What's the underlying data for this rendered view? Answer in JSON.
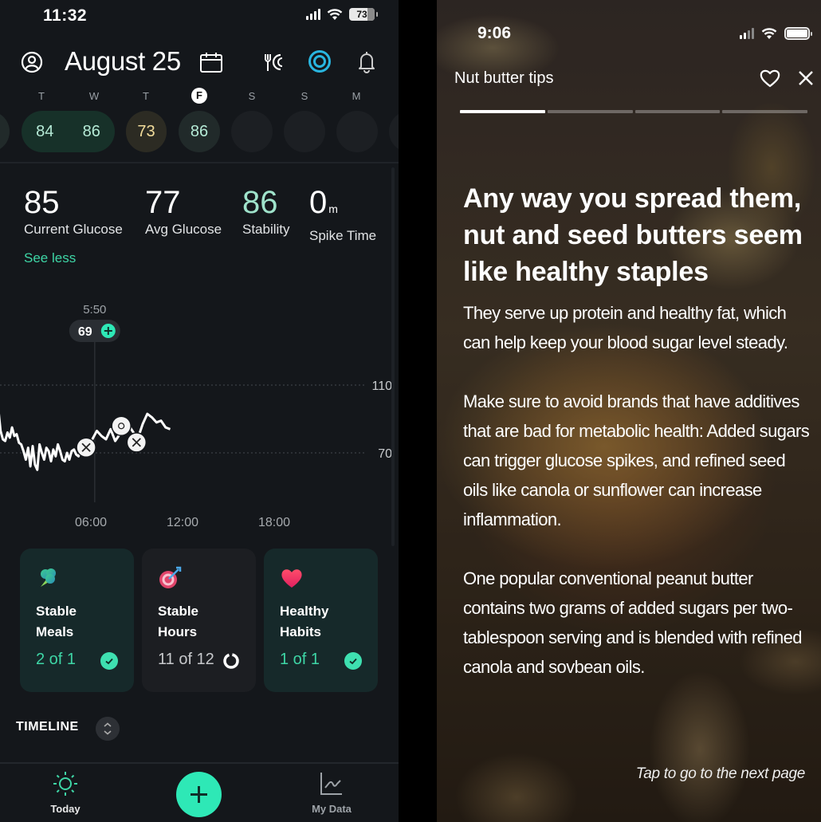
{
  "left_app": {
    "status_bar": {
      "time": "11:32",
      "battery": "73"
    },
    "header": {
      "title": "August 25",
      "icons": [
        "profile-icon",
        "calendar-icon",
        "fork-moon-icon",
        "target-icon",
        "bell-icon"
      ]
    },
    "week": {
      "days": [
        {
          "label": "T",
          "active": false
        },
        {
          "label": "W",
          "active": false
        },
        {
          "label": "T",
          "active": false
        },
        {
          "label": "F",
          "active": true
        },
        {
          "label": "S",
          "active": false
        },
        {
          "label": "S",
          "active": false
        },
        {
          "label": "M",
          "active": false
        }
      ],
      "scores": [
        {
          "day": "T",
          "value": "84",
          "status": "green"
        },
        {
          "day": "W",
          "value": "86",
          "status": "green"
        },
        {
          "day": "T",
          "value": "73",
          "status": "yellow"
        },
        {
          "day": "F",
          "value": "86",
          "status": "gray"
        },
        {
          "day": "S",
          "value": "",
          "status": "empty"
        },
        {
          "day": "S",
          "value": "",
          "status": "empty"
        },
        {
          "day": "M",
          "value": "",
          "status": "empty"
        }
      ]
    },
    "stats": [
      {
        "value": "85",
        "unit": "",
        "label": "Current Glucose"
      },
      {
        "value": "77",
        "unit": "",
        "label": "Avg Glucose"
      },
      {
        "value": "86",
        "unit": "",
        "label": "Stability"
      },
      {
        "value": "0",
        "unit": "m",
        "label": "Spike Time"
      }
    ],
    "see_less": "See less",
    "chart": {
      "cursor_time": "5:50",
      "cursor_value": "69",
      "y_ticks": [
        "110",
        "70"
      ],
      "x_ticks": [
        "06:00",
        "12:00",
        "18:00"
      ],
      "events": [
        "meal-icon",
        "sun-icon",
        "meal-icon"
      ]
    },
    "cards": [
      {
        "icon": "broccoli-icon",
        "title_line1": "Stable",
        "title_line2": "Meals",
        "progress": "2 of 1",
        "state": "done"
      },
      {
        "icon": "target-dart-icon",
        "title_line1": "Stable",
        "title_line2": "Hours",
        "progress": "11 of 12",
        "state": "pending"
      },
      {
        "icon": "heart-icon",
        "title_line1": "Healthy",
        "title_line2": "Habits",
        "progress": "1 of 1",
        "state": "done"
      }
    ],
    "timeline_label": "TIMELINE",
    "bottom_nav": {
      "today": "Today",
      "add": "+",
      "my_data": "My Data"
    },
    "colors": {
      "accent": "#2ee8b6",
      "text_green": "#3ed6a6",
      "target_blue": "#29b6e0"
    }
  },
  "right_app": {
    "status_bar": {
      "time": "9:06"
    },
    "header": {
      "title": "Nut butter tips"
    },
    "story_progress": {
      "pages": 4,
      "current": 1
    },
    "headline": "Any way you spread them, nut and seed butters seem like healthy staples",
    "paragraphs": [
      "They serve up protein and healthy fat, which can help keep your blood sugar level steady.",
      "Make sure to avoid brands that have additives that are bad for metabolic health: Added sugars can trigger glucose spikes, and refined seed oils like canola or sunflower can increase inflammation.",
      "One popular conventional peanut butter contains two grams of added sugars per two-tablespoon serving and is blended with refined canola and sovbean oils."
    ],
    "tap_hint": "Tap to go to the next page"
  },
  "chart_data": {
    "type": "line",
    "title": "",
    "xlabel": "",
    "ylabel": "",
    "x_ticks": [
      "06:00",
      "12:00",
      "18:00"
    ],
    "y_ticks": [
      70,
      110
    ],
    "ylim": [
      50,
      130
    ],
    "xlim_hours": [
      0,
      24
    ],
    "series": [
      {
        "name": "Glucose",
        "x_hours": [
          0.0,
          0.15,
          0.3,
          0.45,
          0.6,
          0.75,
          0.9,
          1.05,
          1.2,
          1.35,
          1.5,
          1.65,
          1.8,
          1.95,
          2.1,
          2.25,
          2.4,
          2.55,
          2.7,
          2.85,
          3.0,
          3.15,
          3.3,
          3.45,
          3.6,
          3.75,
          3.9,
          4.05,
          4.2,
          4.35,
          4.5,
          4.65,
          4.8,
          4.95,
          5.1,
          5.25,
          5.4,
          5.55,
          5.7,
          5.85,
          6.0,
          6.3,
          6.6,
          6.9,
          7.2,
          7.5,
          7.8,
          8.1,
          8.4,
          8.7,
          9.0,
          9.3,
          9.6,
          9.9,
          10.2,
          10.5,
          10.8,
          11.1,
          11.4
        ],
        "values": [
          87,
          96,
          83,
          78,
          77,
          82,
          79,
          85,
          80,
          81,
          76,
          75,
          71,
          66,
          73,
          62,
          74,
          63,
          60,
          75,
          70,
          66,
          73,
          71,
          65,
          72,
          68,
          75,
          71,
          66,
          65,
          70,
          66,
          71,
          72,
          69,
          68,
          72,
          74,
          75,
          76,
          78,
          83,
          80,
          78,
          84,
          77,
          81,
          84,
          86,
          82,
          79,
          87,
          93,
          91,
          88,
          89,
          85,
          84
        ],
        "color": "#ffffff"
      }
    ],
    "cursor": {
      "time": "5:50",
      "value": 69
    },
    "event_markers": [
      {
        "x_hours": 5.9,
        "type": "meal"
      },
      {
        "x_hours": 8.2,
        "type": "activity"
      },
      {
        "x_hours": 9.2,
        "type": "meal"
      }
    ],
    "grid": "dotted horizontal at 70 and 110",
    "legend": "none"
  }
}
